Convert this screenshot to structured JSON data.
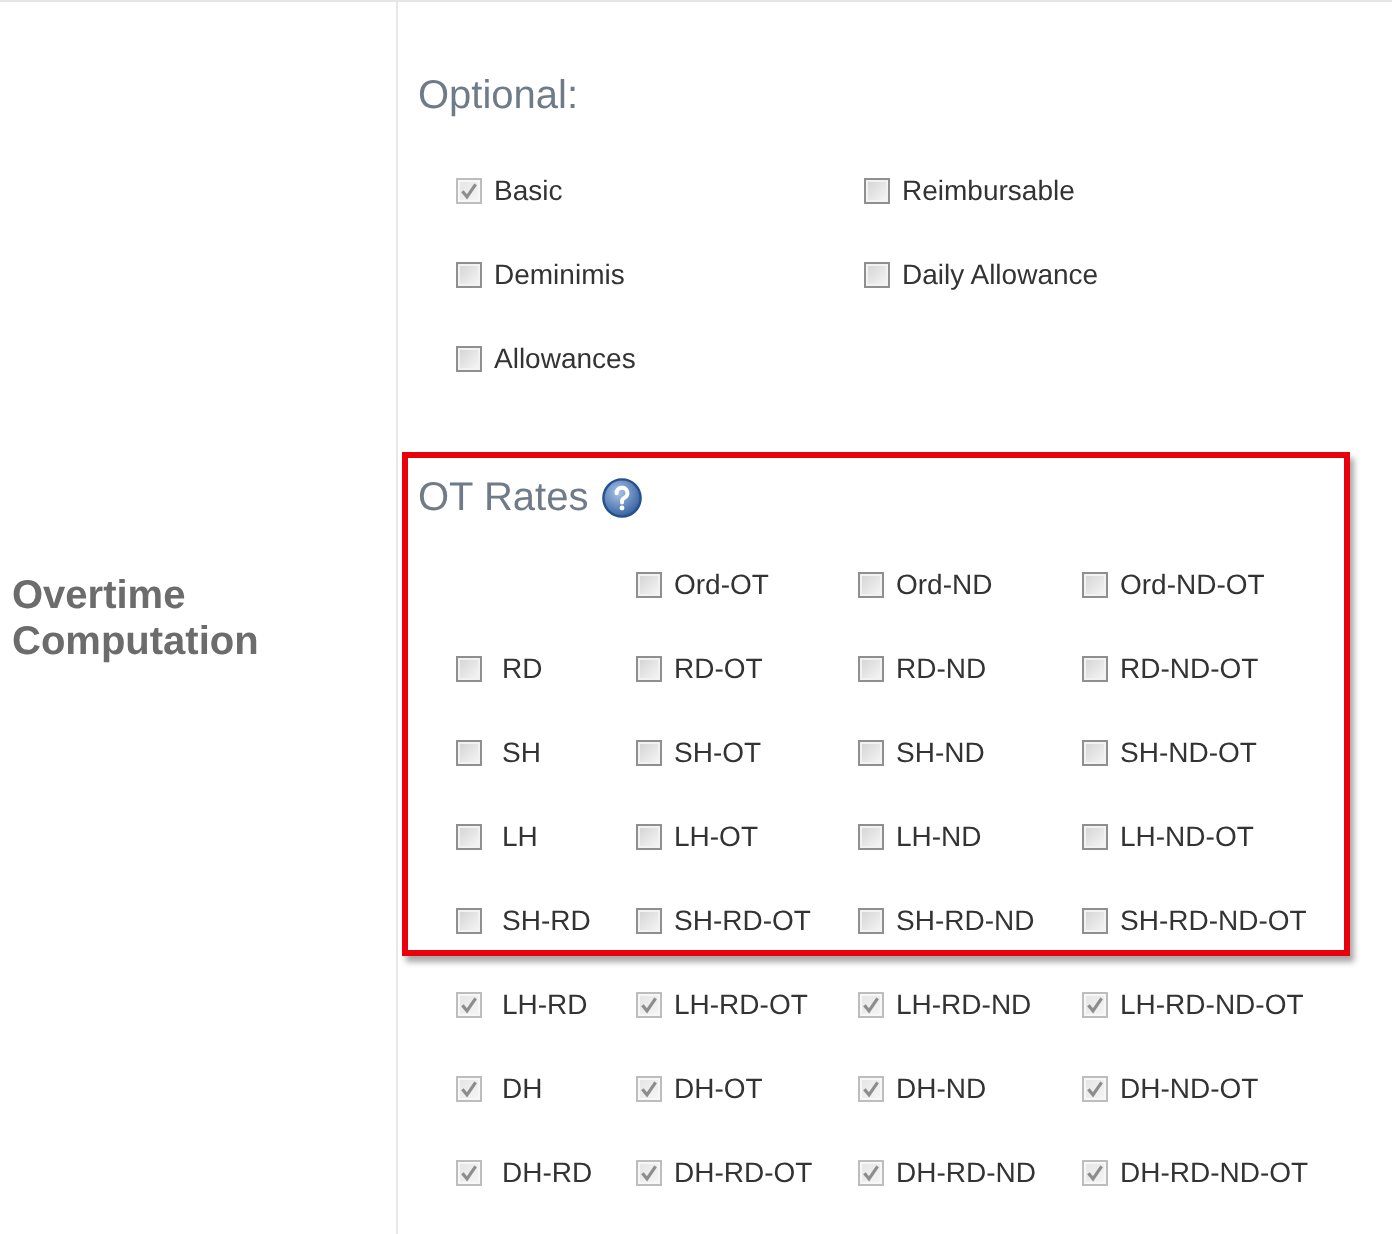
{
  "section": {
    "label": "Overtime Computation"
  },
  "optional": {
    "heading": "Optional:",
    "items": [
      {
        "label": "Basic",
        "checked": true,
        "disabled": true
      },
      {
        "label": "Reimbursable",
        "checked": false,
        "disabled": false
      },
      {
        "label": "Deminimis",
        "checked": false,
        "disabled": false
      },
      {
        "label": "Daily Allowance",
        "checked": false,
        "disabled": false
      },
      {
        "label": "Allowances",
        "checked": false,
        "disabled": false
      }
    ]
  },
  "ot_rates": {
    "heading": "OT Rates",
    "outlined": true,
    "rows": [
      [
        "",
        {
          "label": "Ord-OT",
          "checked": false,
          "disabled": false
        },
        {
          "label": "Ord-ND",
          "checked": false,
          "disabled": false
        },
        {
          "label": "Ord-ND-OT",
          "checked": false,
          "disabled": false
        }
      ],
      [
        {
          "label": "RD",
          "checked": false,
          "disabled": false
        },
        {
          "label": "RD-OT",
          "checked": false,
          "disabled": false
        },
        {
          "label": "RD-ND",
          "checked": false,
          "disabled": false
        },
        {
          "label": "RD-ND-OT",
          "checked": false,
          "disabled": false
        }
      ],
      [
        {
          "label": "SH",
          "checked": false,
          "disabled": false
        },
        {
          "label": "SH-OT",
          "checked": false,
          "disabled": false
        },
        {
          "label": "SH-ND",
          "checked": false,
          "disabled": false
        },
        {
          "label": "SH-ND-OT",
          "checked": false,
          "disabled": false
        }
      ],
      [
        {
          "label": "LH",
          "checked": false,
          "disabled": false
        },
        {
          "label": "LH-OT",
          "checked": false,
          "disabled": false
        },
        {
          "label": "LH-ND",
          "checked": false,
          "disabled": false
        },
        {
          "label": "LH-ND-OT",
          "checked": false,
          "disabled": false
        }
      ],
      [
        {
          "label": "SH-RD",
          "checked": false,
          "disabled": false
        },
        {
          "label": "SH-RD-OT",
          "checked": false,
          "disabled": false
        },
        {
          "label": "SH-RD-ND",
          "checked": false,
          "disabled": false
        },
        {
          "label": "SH-RD-ND-OT",
          "checked": false,
          "disabled": false
        }
      ]
    ]
  },
  "ot_rates_continued": {
    "rows": [
      [
        {
          "label": "LH-RD",
          "checked": true,
          "disabled": true
        },
        {
          "label": "LH-RD-OT",
          "checked": true,
          "disabled": true
        },
        {
          "label": "LH-RD-ND",
          "checked": true,
          "disabled": true
        },
        {
          "label": "LH-RD-ND-OT",
          "checked": true,
          "disabled": true
        }
      ],
      [
        {
          "label": "DH",
          "checked": true,
          "disabled": true
        },
        {
          "label": "DH-OT",
          "checked": true,
          "disabled": true
        },
        {
          "label": "DH-ND",
          "checked": true,
          "disabled": true
        },
        {
          "label": "DH-ND-OT",
          "checked": true,
          "disabled": true
        }
      ],
      [
        {
          "label": "DH-RD",
          "checked": true,
          "disabled": true
        },
        {
          "label": "DH-RD-OT",
          "checked": true,
          "disabled": true
        },
        {
          "label": "DH-RD-ND",
          "checked": true,
          "disabled": true
        },
        {
          "label": "DH-RD-ND-OT",
          "checked": true,
          "disabled": true
        }
      ]
    ]
  }
}
